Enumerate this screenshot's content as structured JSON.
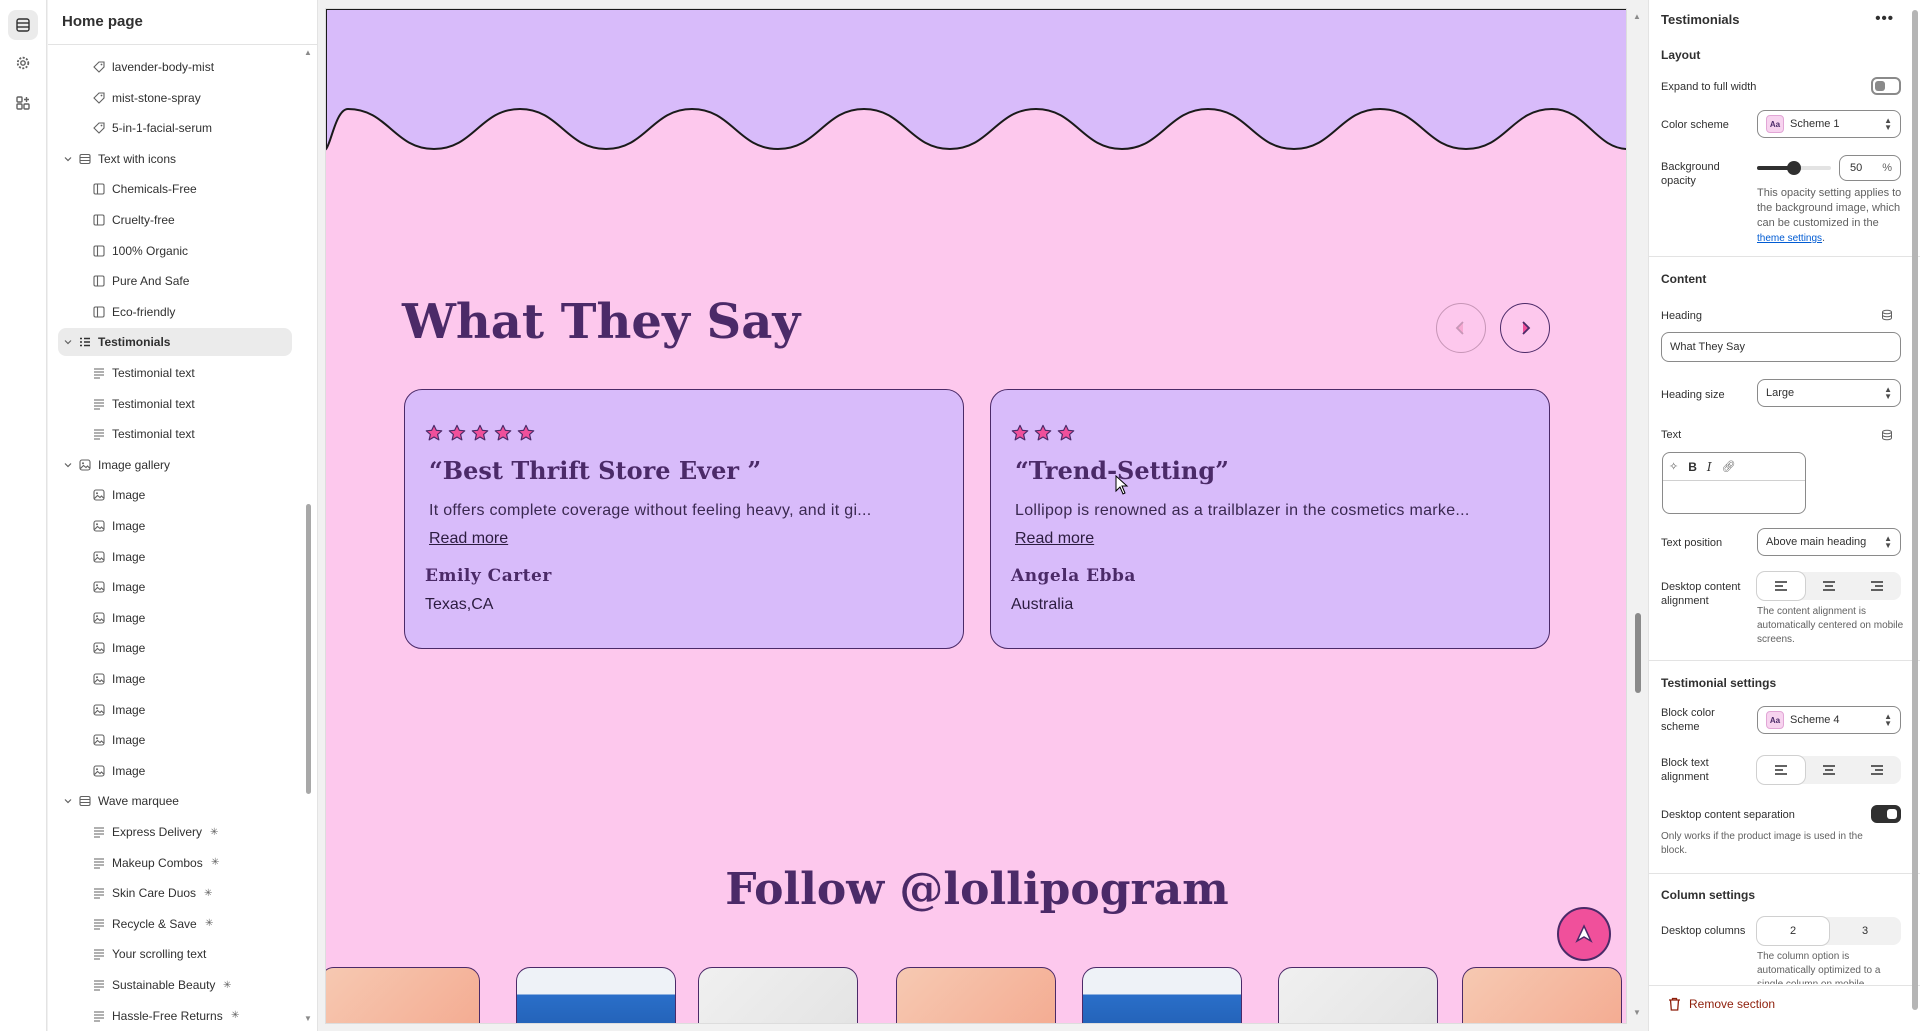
{
  "sidebar": {
    "title": "Home page",
    "rows": [
      {
        "label": "lavender-body-mist",
        "level": 2,
        "icon": "tag-icon",
        "name": "sidebar-item-lavender-body-mist"
      },
      {
        "label": "mist-stone-spray",
        "level": 2,
        "icon": "tag-icon",
        "name": "sidebar-item-mist-stone-spray"
      },
      {
        "label": "5-in-1-facial-serum",
        "level": 2,
        "icon": "tag-icon",
        "name": "sidebar-item-5-in-1-facial-serum"
      },
      {
        "label": "Text with icons",
        "level": 1,
        "icon": "section-icon",
        "expanded": true,
        "name": "sidebar-item-text-with-icons"
      },
      {
        "label": "Chemicals-Free",
        "level": 2,
        "icon": "column-icon",
        "name": "sidebar-item-chemicals-free"
      },
      {
        "label": "Cruelty-free",
        "level": 2,
        "icon": "column-icon",
        "name": "sidebar-item-cruelty-free"
      },
      {
        "label": "100% Organic",
        "level": 2,
        "icon": "column-icon",
        "name": "sidebar-item-100-organic"
      },
      {
        "label": "Pure And Safe",
        "level": 2,
        "icon": "column-icon",
        "name": "sidebar-item-pure-and-safe"
      },
      {
        "label": "Eco-friendly",
        "level": 2,
        "icon": "column-icon",
        "name": "sidebar-item-eco-friendly"
      },
      {
        "label": "Testimonials",
        "level": 1,
        "icon": "list-icon",
        "expanded": true,
        "selected": true,
        "name": "sidebar-item-testimonials"
      },
      {
        "label": "Testimonial text",
        "level": 2,
        "icon": "text-icon",
        "name": "sidebar-item-testimonial-text"
      },
      {
        "label": "Testimonial text",
        "level": 2,
        "icon": "text-icon",
        "name": "sidebar-item-testimonial-text"
      },
      {
        "label": "Testimonial text",
        "level": 2,
        "icon": "text-icon",
        "name": "sidebar-item-testimonial-text"
      },
      {
        "label": "Image gallery",
        "level": 1,
        "icon": "image-icon",
        "expanded": true,
        "name": "sidebar-item-image-gallery"
      },
      {
        "label": "Image",
        "level": 2,
        "icon": "image-icon",
        "name": "sidebar-item-image"
      },
      {
        "label": "Image",
        "level": 2,
        "icon": "image-icon",
        "name": "sidebar-item-image"
      },
      {
        "label": "Image",
        "level": 2,
        "icon": "image-icon",
        "name": "sidebar-item-image"
      },
      {
        "label": "Image",
        "level": 2,
        "icon": "image-icon",
        "name": "sidebar-item-image"
      },
      {
        "label": "Image",
        "level": 2,
        "icon": "image-icon",
        "name": "sidebar-item-image"
      },
      {
        "label": "Image",
        "level": 2,
        "icon": "image-icon",
        "name": "sidebar-item-image"
      },
      {
        "label": "Image",
        "level": 2,
        "icon": "image-icon",
        "name": "sidebar-item-image"
      },
      {
        "label": "Image",
        "level": 2,
        "icon": "image-icon",
        "name": "sidebar-item-image"
      },
      {
        "label": "Image",
        "level": 2,
        "icon": "image-icon",
        "name": "sidebar-item-image"
      },
      {
        "label": "Image",
        "level": 2,
        "icon": "image-icon",
        "name": "sidebar-item-image"
      },
      {
        "label": "Wave marquee",
        "level": 1,
        "icon": "section-icon",
        "expanded": true,
        "name": "sidebar-item-wave-marquee"
      },
      {
        "label": "Express Delivery",
        "level": 2,
        "icon": "text-icon",
        "spark": true,
        "name": "sidebar-item-express-delivery"
      },
      {
        "label": "Makeup Combos",
        "level": 2,
        "icon": "text-icon",
        "spark": true,
        "name": "sidebar-item-makeup-combos"
      },
      {
        "label": "Skin Care Duos",
        "level": 2,
        "icon": "text-icon",
        "spark": true,
        "name": "sidebar-item-skin-care-duos"
      },
      {
        "label": "Recycle & Save",
        "level": 2,
        "icon": "text-icon",
        "spark": true,
        "name": "sidebar-item-recycle-save"
      },
      {
        "label": "Your scrolling text",
        "level": 2,
        "icon": "text-icon",
        "name": "sidebar-item-your-scrolling-text"
      },
      {
        "label": "Sustainable Beauty",
        "level": 2,
        "icon": "text-icon",
        "spark": true,
        "name": "sidebar-item-sustainable-beauty"
      },
      {
        "label": "Hassle-Free Returns",
        "level": 2,
        "icon": "text-icon",
        "spark": true,
        "name": "sidebar-item-hassle-free-returns"
      }
    ]
  },
  "preview": {
    "heading": "What They Say",
    "follow_heading": "Follow @lollipogram",
    "cards": [
      {
        "stars": 5,
        "quote": "“Best Thrift Store Ever ”",
        "text": "It offers complete coverage without feeling heavy, and it gi...",
        "read_more": "Read more",
        "author": "Emily Carter",
        "location": "Texas,CA"
      },
      {
        "stars": 3,
        "quote": "“Trend-Setting”",
        "text": "Lollipop is renowned as a trailblazer in the cosmetics marke...",
        "read_more": "Read more",
        "author": "Angela  Ebba",
        "location": "Australia"
      }
    ]
  },
  "panel": {
    "title": "Testimonials",
    "more": "•••",
    "layout_heading": "Layout",
    "expand_label": "Expand to full width",
    "expand_on": false,
    "color_scheme_label": "Color scheme",
    "color_scheme_value": "Scheme 1",
    "swatch_text": "Aa",
    "bg_opacity_label": "Background opacity",
    "bg_opacity_value": "50",
    "bg_opacity_unit": "%",
    "bg_opacity_level": 0.5,
    "bg_help_text": "This opacity setting applies to the background image, which can be customized in the",
    "bg_help_link": "theme settings",
    "bg_help_end": ".",
    "content_heading": "Content",
    "heading_label": "Heading",
    "heading_value": "What They Say",
    "heading_size_label": "Heading size",
    "heading_size_value": "Large",
    "text_label": "Text",
    "text_position_label": "Text position",
    "text_position_value": "Above main heading",
    "desktop_alignment_label": "Desktop content alignment",
    "alignment_help": "The content alignment is automatically centered on mobile screens.",
    "testimonial_settings_heading": "Testimonial settings",
    "block_color_scheme_label": "Block color scheme",
    "block_color_scheme_value": "Scheme 4",
    "block_text_alignment_label": "Block text alignment",
    "separation_label": "Desktop content separation",
    "separation_on": true,
    "separation_help": "Only works if the product image is used in the block.",
    "column_settings_heading": "Column settings",
    "desktop_columns_label": "Desktop columns",
    "column_options": [
      "2",
      "3"
    ],
    "column_help": "The column option is automatically optimized to a single column on mobile.",
    "remove_label": "Remove section"
  },
  "colors": {
    "page_bg": "#fdc8ed",
    "wave_bg": "#d8bbfa",
    "heading": "#4b2a68",
    "star": "#f0509b",
    "fab": "#f0509b"
  }
}
